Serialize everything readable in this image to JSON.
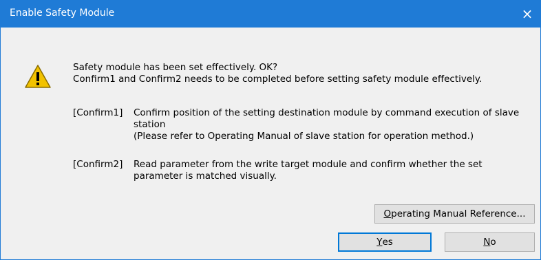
{
  "window": {
    "title": "Enable Safety Module",
    "close_glyph": "×"
  },
  "message": {
    "line1": "Safety module has been set effectively. OK?",
    "line2": "Confirm1 and Confirm2 needs to be completed before setting safety module effectively."
  },
  "confirm1": {
    "label": "[Confirm1]",
    "line1": "Confirm position of the setting destination module by command execution of slave",
    "line2": "station",
    "line3": "(Please refer to Operating Manual of slave station for operation method.)"
  },
  "confirm2": {
    "label": "[Confirm2]",
    "line1": "Read parameter from the write target module and confirm whether the set",
    "line2": "parameter is matched visually."
  },
  "buttons": {
    "manual": {
      "mnemonic": "O",
      "rest": "perating Manual Reference..."
    },
    "yes": {
      "mnemonic": "Y",
      "rest": "es"
    },
    "no": {
      "mnemonic": "N",
      "rest": "o"
    }
  },
  "icons": {
    "warning": "warning-icon",
    "close": "close-icon"
  },
  "colors": {
    "titlebar": "#1f7bd6",
    "warning_fill": "#f2c200"
  }
}
